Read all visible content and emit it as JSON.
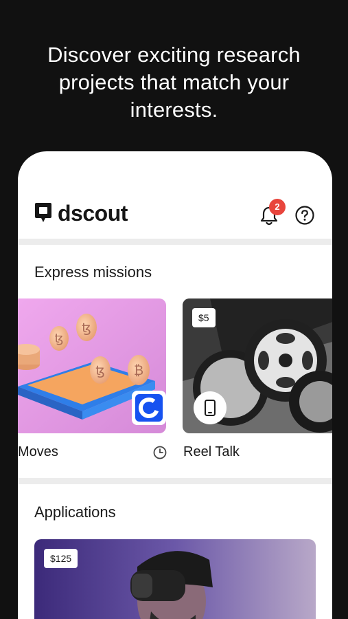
{
  "promo": {
    "headline": "Discover exciting research\nprojects that match your\ninterests."
  },
  "header": {
    "app_name": "dscout",
    "notification_count": "2"
  },
  "express": {
    "title": "Express missions",
    "cards": [
      {
        "label": "Moves"
      },
      {
        "label": "Reel Talk",
        "price": "$5"
      }
    ]
  },
  "applications": {
    "title": "Applications",
    "cards": [
      {
        "price": "$125"
      }
    ]
  },
  "colors": {
    "background": "#111111",
    "badge": "#e8453c",
    "coinbase_blue": "#1652f0"
  }
}
